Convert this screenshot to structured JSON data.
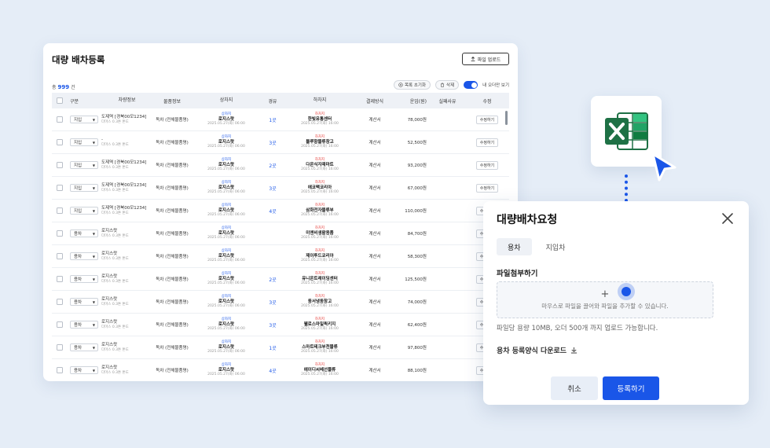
{
  "card": {
    "title": "대량 배차등록",
    "upload_label": "파일 업로드",
    "count_prefix": "총",
    "count": "999",
    "count_suffix": "건",
    "reset_label": "목록 초기화",
    "delete_label": "삭제",
    "toggle_label": "내 오더만 보기"
  },
  "table": {
    "headers": [
      "구분",
      "차량정보",
      "물품정보",
      "상차지",
      "경유",
      "하차지",
      "결제방식",
      "운임(원)",
      "실패사유",
      "수정"
    ],
    "rows": [
      {
        "type": "지입",
        "car1": "도제역 [경북00모1234]",
        "car2": "다마스 0.3톤 톤도",
        "goods": "독차 (전체물품명)",
        "load_tag": "상차지",
        "load": "로지스랏",
        "load_date": "2025.05.27(화) 06:00",
        "via": "1곳",
        "unload_tag": "하차지",
        "unload": "한빛유통센터",
        "unload_date": "2025.05.27(화) 16:00",
        "pay": "계산서",
        "fare": "78,000원",
        "edit": "수정하기"
      },
      {
        "type": "지입",
        "car1": "-",
        "car2": "다마스 0.3톤 톤도",
        "goods": "독차 (전체물품명)",
        "load_tag": "상차지",
        "load": "로지스랏",
        "load_date": "2025.05.27(화) 06:00",
        "via": "3곳",
        "unload_tag": "하차지",
        "unload": "블루항물류창고",
        "unload_date": "2025.05.27(화) 16:00",
        "pay": "계산서",
        "fare": "52,500원",
        "edit": "수정하기"
      },
      {
        "type": "지입",
        "car1": "도제역 [경북00모1234]",
        "car2": "다마스 0.3톤 톤도",
        "goods": "독차 (전체물품명)",
        "load_tag": "상차지",
        "load": "로지스랏",
        "load_date": "2025.05.27(화) 06:00",
        "via": "2곳",
        "unload_tag": "하차지",
        "unload": "다온식자재마트",
        "unload_date": "2025.05.27(화) 16:00",
        "pay": "계산서",
        "fare": "93,200원",
        "edit": "수정하기"
      },
      {
        "type": "지입",
        "car1": "도제역 [경북00모1234]",
        "car2": "다마스 0.3톤 톤도",
        "goods": "독차 (전체물품명)",
        "load_tag": "상차지",
        "load": "로지스랏",
        "load_date": "2025.05.27(화) 06:00",
        "via": "3곳",
        "unload_tag": "하차지",
        "unload": "에코팩코리아",
        "unload_date": "2025.05.27(화) 16:00",
        "pay": "계산서",
        "fare": "67,000원",
        "edit": "수정하기"
      },
      {
        "type": "지입",
        "car1": "도제역 [경북00모1234]",
        "car2": "다마스 0.3톤 톤도",
        "goods": "독차 (전체물품명)",
        "load_tag": "상차지",
        "load": "로지스랏",
        "load_date": "2025.05.27(화) 06:00",
        "via": "4곳",
        "unload_tag": "하차지",
        "unload": "삼화전자물류부",
        "unload_date": "2025.05.27(화) 16:00",
        "pay": "계산서",
        "fare": "110,000원",
        "edit": "수정하기"
      },
      {
        "type": "용차",
        "car1": "로지스랏",
        "car2": "다마스 0.3톤 톤도",
        "goods": "독차 (전체물품명)",
        "load_tag": "상차지",
        "load": "로지스랏",
        "load_date": "2025.05.27(화) 06:00",
        "via": "",
        "unload_tag": "하차지",
        "unload": "미엔비생활용품",
        "unload_date": "2025.05.27(화) 16:00",
        "pay": "계산서",
        "fare": "84,700원",
        "edit": "수정하기"
      },
      {
        "type": "용차",
        "car1": "로지스랏",
        "car2": "다마스 0.3톤 톤도",
        "goods": "독차 (전체물품명)",
        "load_tag": "상차지",
        "load": "로지스랏",
        "load_date": "2025.05.27(화) 06:00",
        "via": "",
        "unload_tag": "하차지",
        "unload": "제이투드코리아",
        "unload_date": "2025.05.27(화) 16:00",
        "pay": "계산서",
        "fare": "58,300원",
        "edit": "수정하기"
      },
      {
        "type": "용차",
        "car1": "로지스랏",
        "car2": "다마스 0.3톤 톤도",
        "goods": "독차 (전체물품명)",
        "load_tag": "상차지",
        "load": "로지스랏",
        "load_date": "2025.05.27(화) 06:00",
        "via": "2곳",
        "unload_tag": "하차지",
        "unload": "유니온트레이딩센터",
        "unload_date": "2025.05.27(화) 16:00",
        "pay": "계산서",
        "fare": "125,500원",
        "edit": "수정하기"
      },
      {
        "type": "용차",
        "car1": "로지스랏",
        "car2": "다마스 0.3톤 톤도",
        "goods": "독차 (전체물품명)",
        "load_tag": "상차지",
        "load": "로지스랏",
        "load_date": "2025.05.27(화) 06:00",
        "via": "3곳",
        "unload_tag": "하차지",
        "unload": "동서냉동창고",
        "unload_date": "2025.05.27(화) 16:00",
        "pay": "계산서",
        "fare": "74,000원",
        "edit": "수정하기"
      },
      {
        "type": "용차",
        "car1": "로지스랏",
        "car2": "다마스 0.3톤 톤도",
        "goods": "독차 (전체물품명)",
        "load_tag": "상차지",
        "load": "로지스랏",
        "load_date": "2025.05.27(화) 06:00",
        "via": "3곳",
        "unload_tag": "하차지",
        "unload": "웰로스마일퀵키지",
        "unload_date": "2025.05.27(화) 16:00",
        "pay": "계산서",
        "fare": "62,400원",
        "edit": "수정하기"
      },
      {
        "type": "용차",
        "car1": "로지스랏",
        "car2": "다마스 0.3톤 톤도",
        "goods": "독차 (전체물품명)",
        "load_tag": "상차지",
        "load": "로지스랏",
        "load_date": "2025.05.27(화) 06:00",
        "via": "1곳",
        "unload_tag": "하차지",
        "unload": "스마트테크부천물류",
        "unload_date": "2025.05.27(화) 16:00",
        "pay": "계산서",
        "fare": "97,800원",
        "edit": "수정하기"
      },
      {
        "type": "용차",
        "car1": "로지스랏",
        "car2": "다마스 0.3톤 톤도",
        "goods": "독차 (전체물품명)",
        "load_tag": "상차지",
        "load": "로지스랏",
        "load_date": "2025.05.27(화) 06:00",
        "via": "4곳",
        "unload_tag": "하차지",
        "unload": "에이디씨베선물류",
        "unload_date": "2025.05.27(화) 16:00",
        "pay": "계산서",
        "fare": "88,100원",
        "edit": "수정하기"
      }
    ]
  },
  "modal": {
    "title": "대량배차요청",
    "tabs": [
      "용차",
      "지입차"
    ],
    "section_label": "파일첨부하기",
    "drop_hint": "마우스로 파일을 끌어와 파일을 추가할 수 있습니다.",
    "limit_text": "파일당 용량 10MB, 오더 500개 까지 업로드 가능합니다.",
    "download_label": "용차 등록양식 다운로드",
    "cancel_label": "취소",
    "submit_label": "등록하기"
  },
  "icons": {
    "excel": "excel-icon",
    "cursor": "cursor-arrow-icon",
    "close": "close-icon",
    "download": "download-icon",
    "upload": "upload-icon"
  },
  "colors": {
    "accent": "#1a56e8",
    "excel_green": "#1e7145",
    "unload_red": "#e53935",
    "background": "#e5edf7"
  }
}
